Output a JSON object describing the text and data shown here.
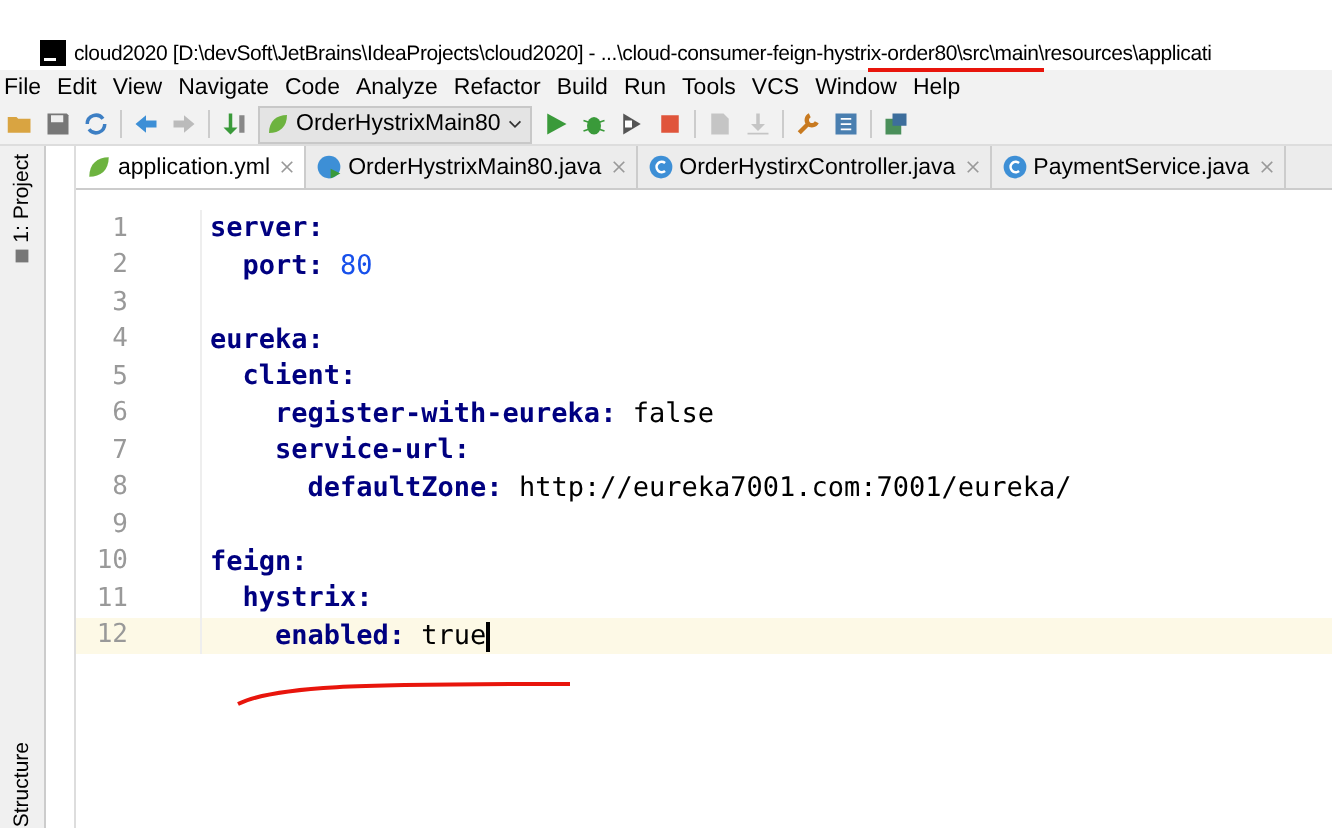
{
  "window": {
    "title": "cloud2020 [D:\\devSoft\\JetBrains\\IdeaProjects\\cloud2020] - ...\\cloud-consumer-feign-hystrix-order80\\src\\main\\resources\\applicati"
  },
  "menu": [
    "File",
    "Edit",
    "View",
    "Navigate",
    "Code",
    "Analyze",
    "Refactor",
    "Build",
    "Run",
    "Tools",
    "VCS",
    "Window",
    "Help"
  ],
  "toolbar": {
    "run_config": "OrderHystrixMain80"
  },
  "side_panels": {
    "top": "1: Project",
    "bottom": "Structure"
  },
  "tabs": [
    {
      "label": "application.yml",
      "kind": "yaml",
      "selected": true
    },
    {
      "label": "OrderHystrixMain80.java",
      "kind": "main",
      "selected": false
    },
    {
      "label": "OrderHystirxController.java",
      "kind": "class",
      "selected": false
    },
    {
      "label": "PaymentService.java",
      "kind": "class",
      "selected": false
    }
  ],
  "lines": [
    {
      "number": "1",
      "key": "server:",
      "current": false
    },
    {
      "number": "2",
      "key": "  port:",
      "value": "80",
      "kind": "number",
      "current": false
    },
    {
      "number": "3",
      "current": false
    },
    {
      "number": "4",
      "key": "eureka:",
      "current": false
    },
    {
      "number": "5",
      "key": "  client:",
      "current": false
    },
    {
      "number": "6",
      "key": "    register-with-eureka:",
      "value": "false",
      "kind": "plain",
      "current": false
    },
    {
      "number": "7",
      "key": "    service-url:",
      "current": false
    },
    {
      "number": "8",
      "key": "      defaultZone:",
      "value": "http://eureka7001.com:7001/eureka/",
      "kind": "plain",
      "current": false
    },
    {
      "number": "9",
      "current": false
    },
    {
      "number": "10",
      "key": "feign:",
      "current": false
    },
    {
      "number": "11",
      "key": "  hystrix:",
      "current": false
    },
    {
      "number": "12",
      "key": "    enabled:",
      "value": "true",
      "kind": "plain",
      "current": true
    }
  ]
}
